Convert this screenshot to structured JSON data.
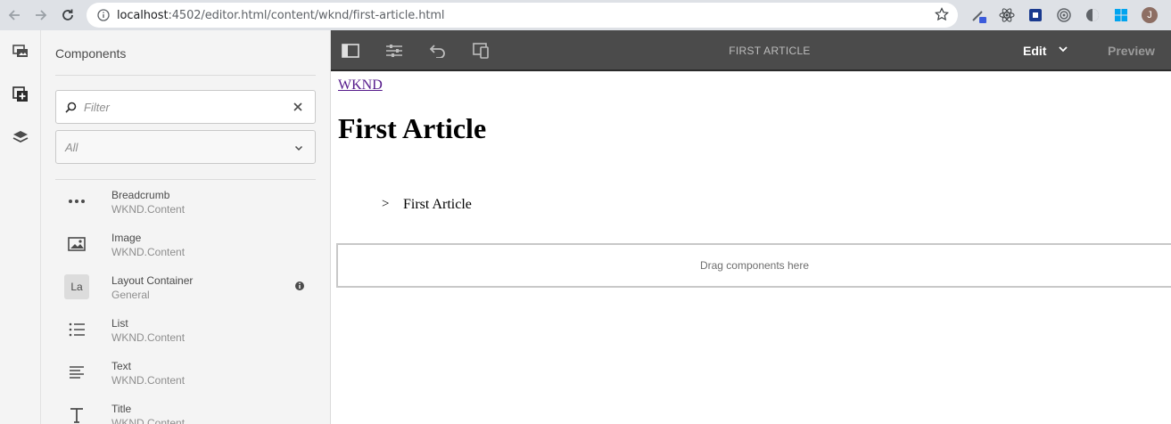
{
  "browser": {
    "url_host": "localhost",
    "url_path": ":4502/editor.html/content/wknd/first-article.html",
    "avatar_initial": "J"
  },
  "panel": {
    "title": "Components",
    "filter_placeholder": "Filter",
    "group_select_value": "All",
    "components": [
      {
        "name": "Breadcrumb",
        "group": "WKND.Content",
        "icon": "more-horizontal-icon"
      },
      {
        "name": "Image",
        "group": "WKND.Content",
        "icon": "image-icon"
      },
      {
        "name": "Layout Container",
        "group": "General",
        "icon": "text-badge",
        "badge": "La",
        "info": true
      },
      {
        "name": "List",
        "group": "WKND.Content",
        "icon": "list-bulleted-icon"
      },
      {
        "name": "Text",
        "group": "WKND.Content",
        "icon": "text-align-left-icon"
      },
      {
        "name": "Title",
        "group": "WKND.Content",
        "icon": "title-t-icon"
      }
    ]
  },
  "toolbar": {
    "page_title": "FIRST ARTICLE",
    "mode_label": "Edit",
    "preview_label": "Preview"
  },
  "page": {
    "site_link": "WKND",
    "heading": "First Article",
    "breadcrumb_separator": ">",
    "breadcrumb_current": "First Article",
    "dropzone_label": "Drag components here"
  },
  "colors": {
    "toolbar_bg": "#4b4b4b",
    "panel_bg": "#f4f4f4",
    "browser_bg": "#dee1e6",
    "link": "#551a8b"
  }
}
